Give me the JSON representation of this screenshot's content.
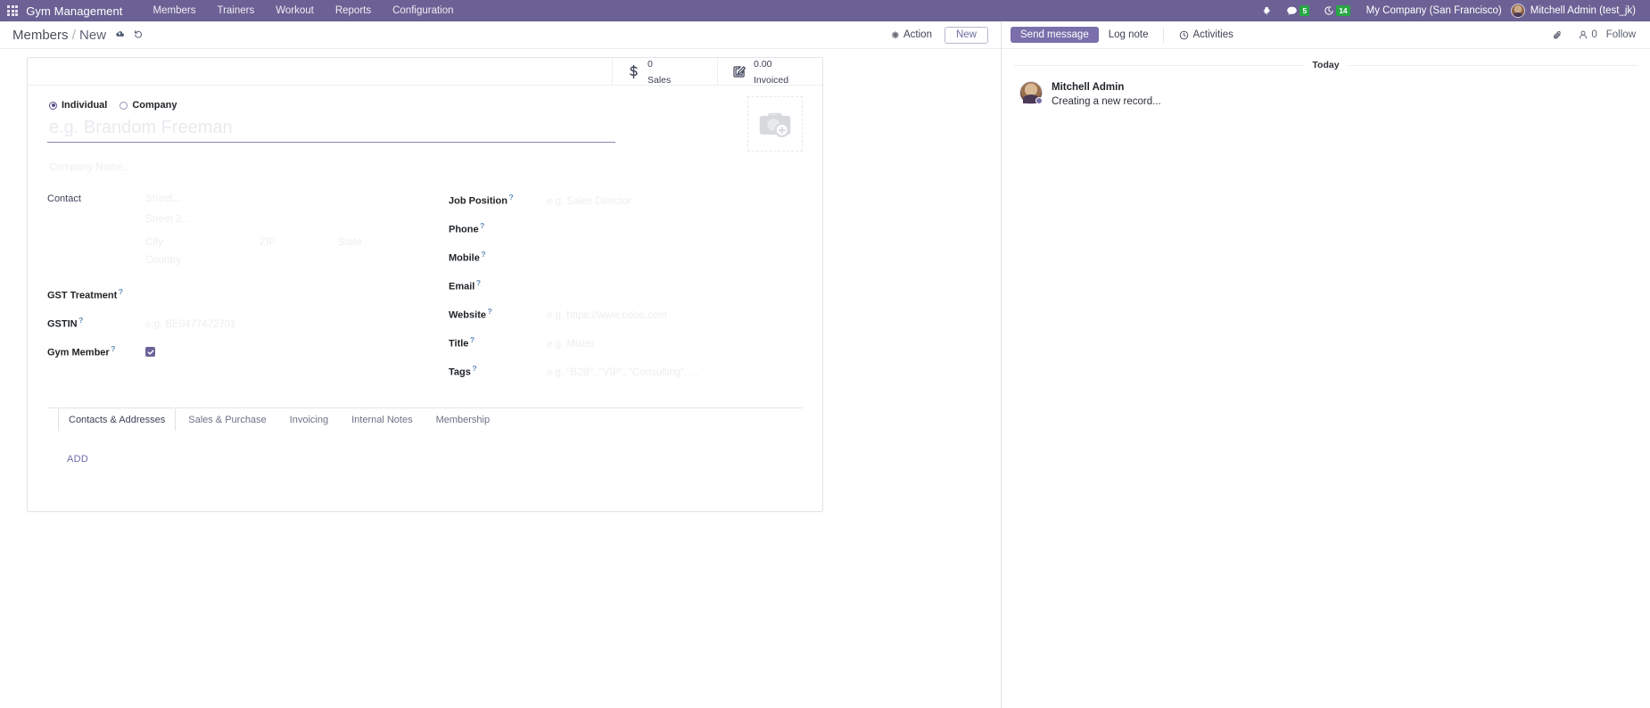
{
  "navbar": {
    "apps_icon": "apps-grid-icon",
    "brand": "Gym Management",
    "menu": [
      "Members",
      "Trainers",
      "Workout",
      "Reports",
      "Configuration"
    ],
    "bug_icon": "bug-icon",
    "messages": {
      "icon": "chat-icon",
      "count": "5"
    },
    "activities": {
      "icon": "clock-icon",
      "count": "14"
    },
    "company": "My Company (San Francisco)",
    "user": "Mitchell Admin (test_jk)",
    "avatar_icon": "user-avatar",
    "bg_color": "#6b6194"
  },
  "control_panel": {
    "breadcrumb_root": "Members",
    "breadcrumb_sep": "/",
    "breadcrumb_current": "New",
    "save_icon": "cloud-upload-icon",
    "discard_icon": "undo-icon",
    "action_label": "Action",
    "action_icon": "gear-icon",
    "new_label": "New"
  },
  "stats": [
    {
      "icon": "dollar-icon",
      "value": "0",
      "label": "Sales"
    },
    {
      "icon": "pencil-square-icon",
      "value": "0.00",
      "label": "Invoiced"
    }
  ],
  "form": {
    "type_options": [
      {
        "label": "Individual",
        "selected": true
      },
      {
        "label": "Company",
        "selected": false
      }
    ],
    "name_placeholder": "e.g. Brandom Freeman",
    "name_value": "",
    "company_name_placeholder": "Company Name...",
    "company_name_value": "",
    "image_placeholder_icon": "camera-add-icon",
    "left": {
      "contact_label": "Contact",
      "street_placeholder": "Street...",
      "street2_placeholder": "Street 2...",
      "city_placeholder": "City",
      "zip_placeholder": "ZIP",
      "state_placeholder": "State",
      "country_placeholder": "Country",
      "gst_treatment_label": "GST Treatment",
      "gstin_label": "GSTIN",
      "gstin_placeholder": "e.g. BE0477472701",
      "gym_member_label": "Gym Member",
      "gym_member_checked": true
    },
    "right": {
      "job_position_label": "Job Position",
      "job_position_placeholder": "e.g. Sales Director",
      "phone_label": "Phone",
      "phone_placeholder": "",
      "mobile_label": "Mobile",
      "mobile_placeholder": "",
      "email_label": "Email",
      "email_placeholder": "",
      "website_label": "Website",
      "website_placeholder": "e.g. https://www.odoo.com",
      "title_label": "Title",
      "title_placeholder": "e.g. Mister",
      "tags_label": "Tags",
      "tags_placeholder": "e.g. \"B2B\", \"VIP\", \"Consulting\", ..."
    },
    "notebook": {
      "tabs": [
        {
          "label": "Contacts & Addresses",
          "active": true
        },
        {
          "label": "Sales & Purchase",
          "active": false
        },
        {
          "label": "Invoicing",
          "active": false
        },
        {
          "label": "Internal Notes",
          "active": false
        },
        {
          "label": "Membership",
          "active": false
        }
      ],
      "add_label": "ADD"
    }
  },
  "chatter": {
    "send_message_label": "Send message",
    "log_note_label": "Log note",
    "activities_label": "Activities",
    "activities_icon": "clock-icon",
    "attachment_icon": "paperclip-icon",
    "followers_icon": "user-icon",
    "followers_count": "0",
    "follow_label": "Follow",
    "day_separator": "Today",
    "messages": [
      {
        "author": "Mitchell Admin",
        "body": "Creating a new record...",
        "avatar_icon": "user-avatar"
      }
    ]
  }
}
